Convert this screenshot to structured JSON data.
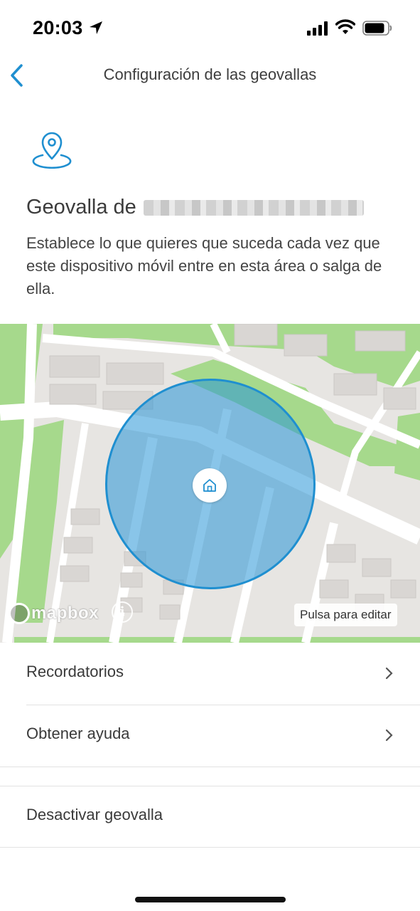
{
  "status_bar": {
    "time": "20:03",
    "icons": [
      "location-arrow-icon",
      "cellular-signal-icon",
      "wifi-icon",
      "battery-icon"
    ]
  },
  "nav": {
    "back_icon": "chevron-left-icon",
    "title": "Configuración de las geovallas"
  },
  "header": {
    "icon": "map-pin-icon",
    "title_prefix": "Geovalla de",
    "description": "Establece lo que quieres que suceda cada vez que este dispositivo móvil entre en esta área o salga de ella."
  },
  "map": {
    "attribution": "mapbox",
    "info_label": "i",
    "edit_label": "Pulsa para editar",
    "center_icon": "home-icon",
    "geofence_color": "#1f8fd0"
  },
  "list": {
    "items": [
      {
        "label": "Recordatorios",
        "icon": "chevron-right-icon"
      },
      {
        "label": "Obtener ayuda",
        "icon": "chevron-right-icon"
      },
      {
        "label": "Desactivar geovalla"
      }
    ]
  },
  "colors": {
    "accent": "#1f8fd0",
    "park": "#a6d98c",
    "map_background": "#e7e5e2"
  }
}
